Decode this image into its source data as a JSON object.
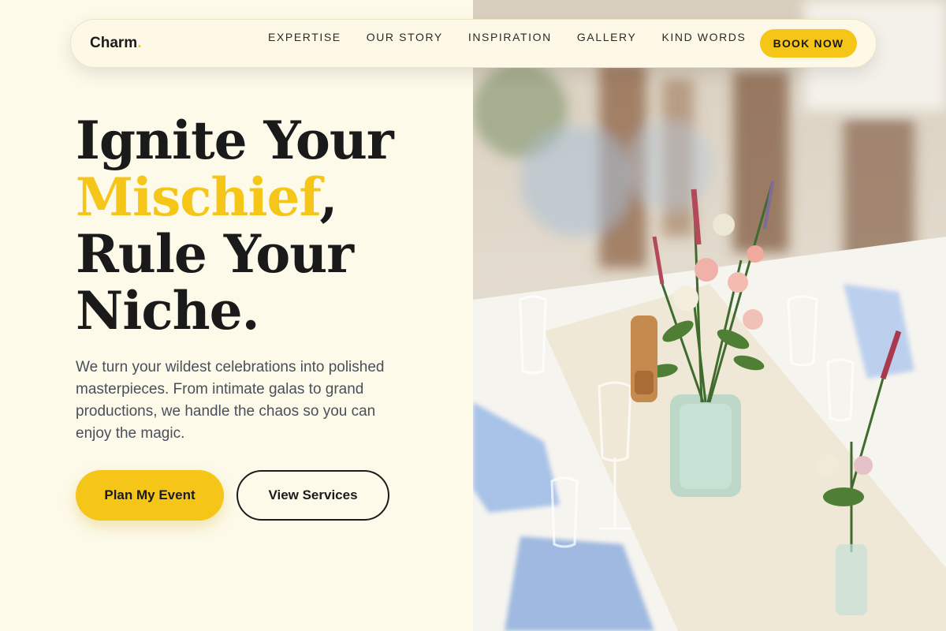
{
  "brand": {
    "name": "Charm",
    "dot": ".",
    "accent_color": "#f5c518"
  },
  "nav": {
    "links": [
      "EXPERTISE",
      "OUR STORY",
      "INSPIRATION",
      "GALLERY",
      "KIND WORDS"
    ],
    "cta": "BOOK NOW"
  },
  "hero": {
    "line1": "Ignite Your",
    "accent": "Mischief",
    "comma": ",",
    "line3": "Rule Your",
    "line4": "Niche.",
    "description": "We turn your wildest celebrations into polished masterpieces. From intimate galas to grand productions, we handle the chaos so you can enjoy the magic.",
    "primary_button": "Plan My Event",
    "secondary_button": "View Services"
  },
  "image": {
    "icon": "photo-wedding-table-flowers"
  }
}
